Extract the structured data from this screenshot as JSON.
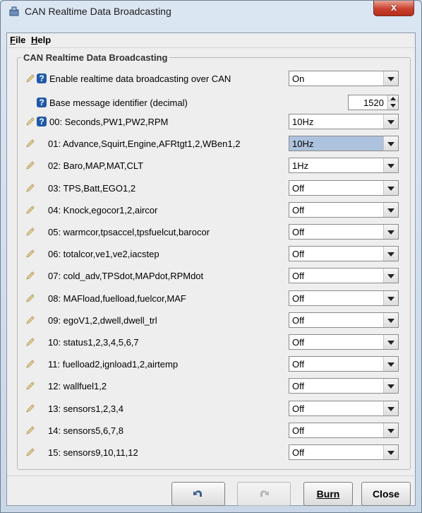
{
  "window": {
    "title": "CAN Realtime Data Broadcasting",
    "close_label": "x"
  },
  "menubar": {
    "file": {
      "mnemonic": "F",
      "rest": "ile"
    },
    "help": {
      "mnemonic": "H",
      "rest": "elp"
    }
  },
  "panel": {
    "title": "CAN Realtime Data Broadcasting"
  },
  "fields": {
    "enable": {
      "label": "Enable realtime data broadcasting over CAN",
      "value": "On"
    },
    "base_id": {
      "label": "Base message identifier (decimal)",
      "value": "1520"
    }
  },
  "messages": [
    {
      "label": "00: Seconds,PW1,PW2,RPM",
      "value": "10Hz"
    },
    {
      "label": "01: Advance,Squirt,Engine,AFRtgt1,2,WBen1,2",
      "value": "10Hz"
    },
    {
      "label": "02: Baro,MAP,MAT,CLT",
      "value": "1Hz"
    },
    {
      "label": "03: TPS,Batt,EGO1,2",
      "value": "Off"
    },
    {
      "label": "04: Knock,egocor1,2,aircor",
      "value": "Off"
    },
    {
      "label": "05: warmcor,tpsaccel,tpsfuelcut,barocor",
      "value": "Off"
    },
    {
      "label": "06: totalcor,ve1,ve2,iacstep",
      "value": "Off"
    },
    {
      "label": "07: cold_adv,TPSdot,MAPdot,RPMdot",
      "value": "Off"
    },
    {
      "label": "08: MAFload,fuelload,fuelcor,MAF",
      "value": "Off"
    },
    {
      "label": "09: egoV1,2,dwell,dwell_trl",
      "value": "Off"
    },
    {
      "label": "10: status1,2,3,4,5,6,7",
      "value": "Off"
    },
    {
      "label": "11: fuelload2,ignload1,2,airtemp",
      "value": "Off"
    },
    {
      "label": "12: wallfuel1,2",
      "value": "Off"
    },
    {
      "label": "13: sensors1,2,3,4",
      "value": "Off"
    },
    {
      "label": "14: sensors5,6,7,8",
      "value": "Off"
    },
    {
      "label": "15: sensors9,10,11,12",
      "value": "Off"
    }
  ],
  "footer": {
    "burn": "Burn",
    "close": "Close"
  },
  "icons": {
    "help": "?",
    "undo": "undo-icon",
    "redo": "redo-icon",
    "pencil": "pencil-icon"
  },
  "colors": {
    "highlight": "#adc2dd",
    "help_icon": "#1f5aa9"
  }
}
